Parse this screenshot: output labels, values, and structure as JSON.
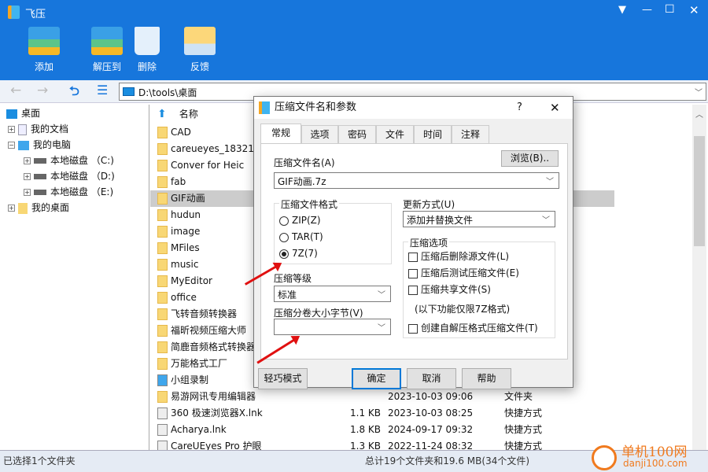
{
  "app": {
    "title": "飞压",
    "controls": [
      "▼",
      "—",
      "☐",
      "✕"
    ]
  },
  "toolbar": [
    {
      "label": "添加",
      "icon": "add-archive-icon"
    },
    {
      "label": "解压到",
      "icon": "extract-icon"
    },
    {
      "label": "删除",
      "icon": "trash-icon"
    },
    {
      "label": "反馈",
      "icon": "feedback-icon"
    }
  ],
  "nav": {
    "address": "D:\\tools\\桌面"
  },
  "tree": [
    {
      "label": "桌面"
    },
    {
      "label": "我的文档"
    },
    {
      "label": "我的电脑"
    },
    {
      "label": "本地磁盘 （C:)"
    },
    {
      "label": "本地磁盘 （D:)"
    },
    {
      "label": "本地磁盘 （E:)"
    },
    {
      "label": "我的桌面"
    }
  ],
  "list": {
    "header_name": "名称",
    "rows": [
      {
        "name": "CAD"
      },
      {
        "name": "careueyes_183214"
      },
      {
        "name": "Conver for Heic"
      },
      {
        "name": "fab"
      },
      {
        "name": "GIF动画",
        "selected": true
      },
      {
        "name": "hudun"
      },
      {
        "name": "image"
      },
      {
        "name": "MFiles"
      },
      {
        "name": "music"
      },
      {
        "name": "MyEditor"
      },
      {
        "name": "office"
      },
      {
        "name": "飞转音频转换器"
      },
      {
        "name": "福昕视频压缩大师"
      },
      {
        "name": "简鹿音频格式转换器"
      },
      {
        "name": "万能格式工厂"
      },
      {
        "name": "小组录制"
      },
      {
        "name": "易游网讯专用编辑器",
        "size": "",
        "date": "2023-10-03 09:06",
        "type": "文件夹"
      },
      {
        "name": "360 极速浏览器X.lnk",
        "size": "1.1 KB",
        "date": "2023-10-03 08:25",
        "type": "快捷方式"
      },
      {
        "name": "Acharya.lnk",
        "size": "1.8 KB",
        "date": "2024-09-17 09:32",
        "type": "快捷方式"
      },
      {
        "name": "CareUEyes Pro 护眼",
        "size": "1.3 KB",
        "date": "2022-11-24 08:32",
        "type": "快捷方式"
      }
    ]
  },
  "status": {
    "left": "已选择1个文件夹",
    "center": "总计19个文件夹和19.6 MB(34个文件)"
  },
  "watermark": {
    "text": "单机100网",
    "url_text": "danji100.com"
  },
  "dialog": {
    "title": "压缩文件名和参数",
    "help": "?",
    "close": "✕",
    "tabs": [
      "常规",
      "选项",
      "密码",
      "文件",
      "时间",
      "注释"
    ],
    "browse": "浏览(B)..",
    "archive_name_label": "压缩文件名(A)",
    "archive_name": "GIF动画.7z",
    "format_group": "压缩文件格式",
    "formats": [
      "ZIP(Z)",
      "TAR(T)",
      "7Z(7)"
    ],
    "format_selected": "7Z(7)",
    "level_label": "压缩等级",
    "level": "标准",
    "volume_label": "压缩分卷大小字节(V)",
    "volume": "",
    "update_label": "更新方式(U)",
    "update": "添加并替换文件",
    "options_group": "压缩选项",
    "options": [
      {
        "label": "压缩后删除源文件(L)",
        "checked": false
      },
      {
        "label": "压缩后测试压缩文件(E)",
        "checked": false
      },
      {
        "label": "压缩共享文件(S)",
        "checked": false
      }
    ],
    "note": "(以下功能仅限7Z格式)",
    "sfx": {
      "label": "创建自解压格式压缩文件(T)",
      "checked": false
    },
    "buttons": {
      "simple": "轻巧模式",
      "ok": "确定",
      "cancel": "取消",
      "help": "帮助"
    }
  },
  "colors": {
    "accent": "#1776dc",
    "annotation_arrow": "#e01010"
  }
}
